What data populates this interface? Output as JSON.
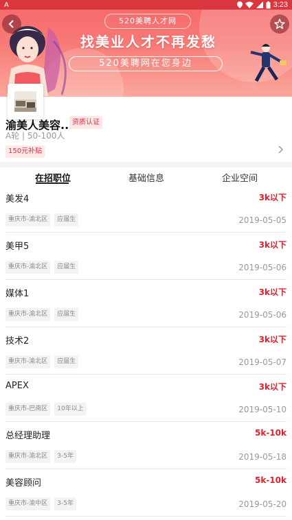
{
  "status_bar": {
    "left_icon": "A",
    "time": "3:23"
  },
  "banner": {
    "top_pill": "520美聘人才网",
    "headline": "找美业人才不再发愁",
    "sub_pill": "520美聘网在您身边",
    "colors": {
      "gradient_top": "#f7676a",
      "gradient_bottom": "#fba79b"
    }
  },
  "company": {
    "name": "渝美人美容...",
    "cert_badge": "资质认证",
    "meta": "A轮 | 50-100人",
    "subsidy_badge": "150元补贴"
  },
  "tabs": [
    {
      "label": "在招职位",
      "active": true
    },
    {
      "label": "基础信息",
      "active": false
    },
    {
      "label": "企业空间",
      "active": false
    }
  ],
  "jobs": [
    {
      "title": "美发4",
      "salary": "3k以下",
      "tags": [
        "重庆市-渝北区",
        "应届生"
      ],
      "date": "2019-05-05"
    },
    {
      "title": "美甲5",
      "salary": "3k以下",
      "tags": [
        "重庆市-渝北区",
        "应届生"
      ],
      "date": "2019-05-06"
    },
    {
      "title": "媒体1",
      "salary": "3k以下",
      "tags": [
        "重庆市-渝北区",
        "应届生"
      ],
      "date": "2019-05-06"
    },
    {
      "title": "技术2",
      "salary": "3k以下",
      "tags": [
        "重庆市-渝北区",
        "应届生"
      ],
      "date": "2019-05-07"
    },
    {
      "title": "APEX",
      "salary": "3k以下",
      "tags": [
        "重庆市-巴南区",
        "10年以上"
      ],
      "date": "2019-05-10"
    },
    {
      "title": "总经理助理",
      "salary": "5k-10k",
      "tags": [
        "重庆市-渝北区",
        "3-5年"
      ],
      "date": "2019-05-18"
    },
    {
      "title": "美容顾问",
      "salary": "5k-10k",
      "tags": [
        "重庆市-渝中区",
        "3-5年"
      ],
      "date": "2019-05-20"
    }
  ],
  "colors": {
    "accent": "#e0212d",
    "status_bar": "#d9363e"
  }
}
